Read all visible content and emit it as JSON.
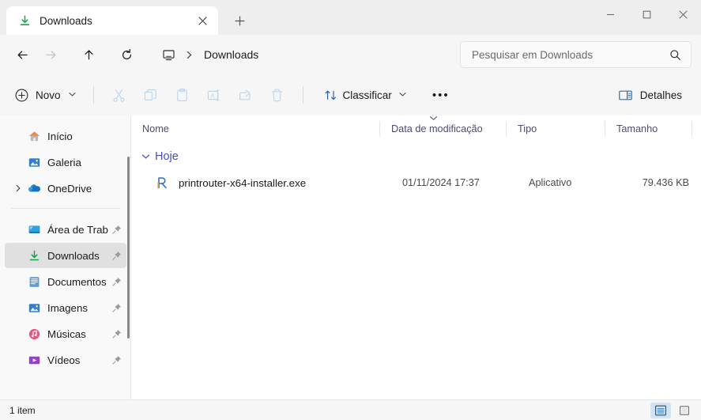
{
  "window": {
    "minimize_label": "Minimizar",
    "maximize_label": "Maximizar",
    "close_label": "Fechar"
  },
  "tabs": {
    "active": {
      "title": "Downloads",
      "icon": "download-arrow-icon",
      "close_label": "✕"
    },
    "new_tab_label": "+"
  },
  "nav": {
    "back_label": "←",
    "forward_label": "→",
    "up_label": "↑",
    "refresh_label": "↻",
    "breadcrumb": {
      "root_icon": "this-pc-monitor-icon",
      "separator": "›",
      "current": "Downloads"
    }
  },
  "search": {
    "placeholder": "Pesquisar em Downloads",
    "icon": "search-icon"
  },
  "toolbar": {
    "new_label": "Novo",
    "new_chevron": "⌄",
    "cut_label": "Recortar",
    "copy_label": "Copiar",
    "paste_label": "Colar",
    "rename_label": "Renomear",
    "share_label": "Compartilhar",
    "delete_label": "Excluir",
    "sort_label": "Classificar",
    "sort_chevron": "⌄",
    "overflow_label": "•••",
    "details_label": "Detalhes"
  },
  "sidebar": {
    "items": [
      {
        "label": "Início",
        "icon": "home-icon",
        "color": "#f0883e",
        "pinned": false,
        "expandable": false,
        "selected": false
      },
      {
        "label": "Galeria",
        "icon": "gallery-icon",
        "color": "#2f7fd0",
        "pinned": false,
        "expandable": false,
        "selected": false
      },
      {
        "label": "OneDrive",
        "icon": "cloud-icon",
        "color": "#1473c4",
        "pinned": false,
        "expandable": true,
        "selected": false
      },
      {
        "label": "Área de Trab",
        "icon": "desktop-icon",
        "color": "#2aa3e0",
        "pinned": true,
        "expandable": false,
        "selected": false
      },
      {
        "label": "Downloads",
        "icon": "download-icon",
        "color": "#16a34a",
        "pinned": true,
        "expandable": false,
        "selected": true
      },
      {
        "label": "Documentos",
        "icon": "document-icon",
        "color": "#5b9bd5",
        "pinned": true,
        "expandable": false,
        "selected": false
      },
      {
        "label": "Imagens",
        "icon": "pictures-icon",
        "color": "#2f7fd0",
        "pinned": true,
        "expandable": false,
        "selected": false
      },
      {
        "label": "Músicas",
        "icon": "music-icon",
        "color": "#e8557f",
        "pinned": true,
        "expandable": false,
        "selected": false
      },
      {
        "label": "Vídeos",
        "icon": "video-icon",
        "color": "#9b3bd4",
        "pinned": true,
        "expandable": false,
        "selected": false
      }
    ],
    "pin_glyph": "📌"
  },
  "columns": [
    {
      "label": "Nome",
      "key": "name"
    },
    {
      "label": "Data de modificação",
      "key": "date",
      "sorted": true,
      "sort_dir": "⌄"
    },
    {
      "label": "Tipo",
      "key": "type"
    },
    {
      "label": "Tamanho",
      "key": "size"
    }
  ],
  "file_list": {
    "groups": [
      {
        "label": "Hoje",
        "chevron": "⌄",
        "color": "#4a4fb8",
        "rows": [
          {
            "name": "printrouter-x64-installer.exe",
            "date": "01/11/2024 17:37",
            "type": "Aplicativo",
            "size": "79.436 KB",
            "icon": "installer-app-icon"
          }
        ]
      }
    ]
  },
  "status": {
    "item_count": "1 item",
    "view_details_label": "Detalhes",
    "view_icons_label": "Ícones grandes"
  },
  "colors": {
    "accent": "#4a4fb8",
    "selection": "#e0e0e0",
    "chrome": "#f6f6f6",
    "titlebar": "#eeeeee",
    "disabled_icon": "#bdd7f0",
    "view_active": "#cfe4f7"
  }
}
